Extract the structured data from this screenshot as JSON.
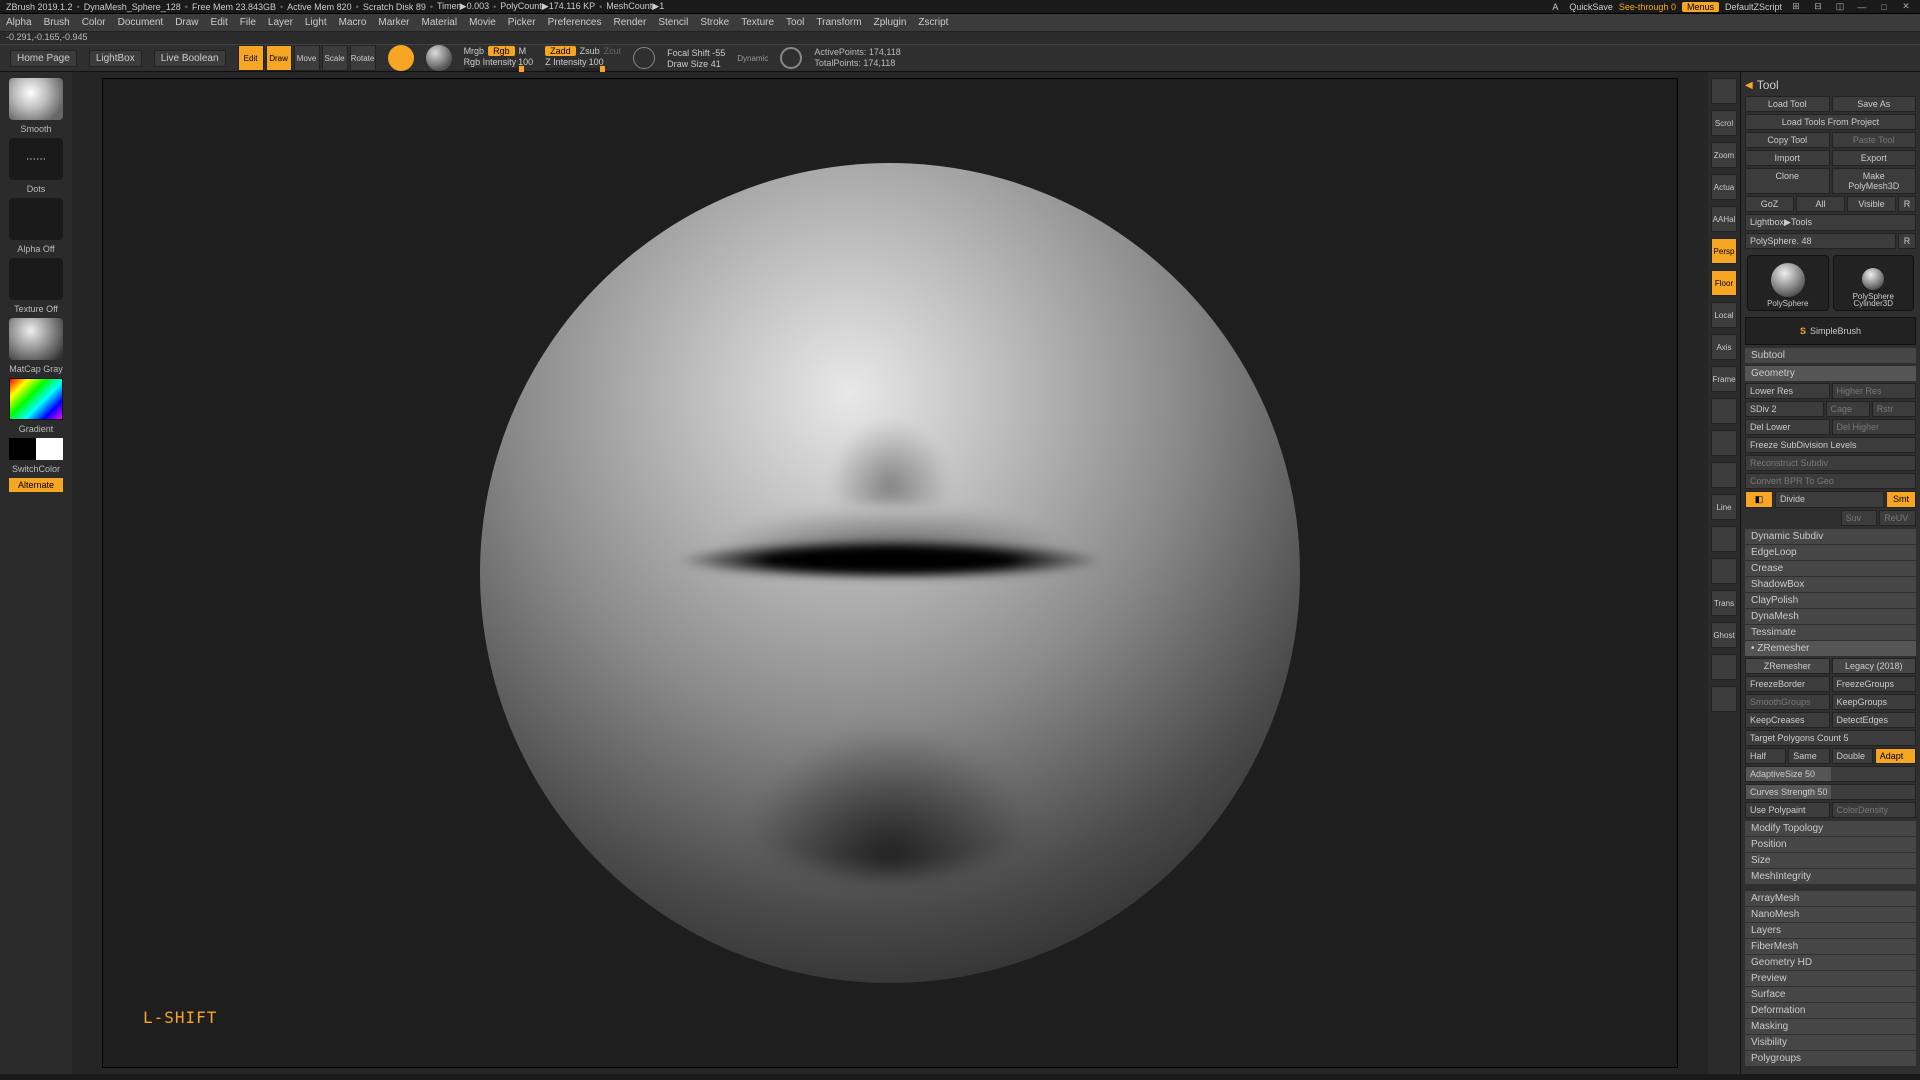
{
  "top": {
    "app": "ZBrush 2019.1.2",
    "project": "DynaMesh_Sphere_128",
    "freemem": "Free Mem 23.843GB",
    "activemem": "Active Mem 820",
    "scratch": "Scratch Disk 89",
    "timer": "Timer▶0.003",
    "polycount": "PolyCount▶174.116 KP",
    "meshcount": "MeshCount▶1",
    "adaptive": "A",
    "quicksave": "QuickSave",
    "seethrough": "See-through  0",
    "menus": "Menus",
    "defaultz": "DefaultZScript"
  },
  "menus": [
    "Alpha",
    "Brush",
    "Color",
    "Document",
    "Draw",
    "Edit",
    "File",
    "Layer",
    "Light",
    "Macro",
    "Marker",
    "Material",
    "Movie",
    "Picker",
    "Preferences",
    "Render",
    "Stencil",
    "Stroke",
    "Texture",
    "Tool",
    "Transform",
    "Zplugin",
    "Zscript"
  ],
  "coords": "-0.291,-0.165,-0.945",
  "shelf": {
    "home": "Home Page",
    "lightbox": "LightBox",
    "liveboolean": "Live Boolean",
    "modes": [
      "Edit",
      "Draw",
      "Move",
      "Scale",
      "Rotate"
    ],
    "mrgb": "Mrgb",
    "rgb": "Rgb",
    "m": "M",
    "rgbint_label": "Rgb Intensity",
    "rgbint": "100",
    "zadd": "Zadd",
    "zsub": "Zsub",
    "zcut": "Zcut",
    "zint_label": "Z Intensity",
    "zint": "100",
    "focal_label": "Focal Shift",
    "focal": "-55",
    "draw_label": "Draw Size",
    "draw": "41",
    "dynamic": "Dynamic",
    "active": "ActivePoints: 174,118",
    "total": "TotalPoints: 174,118"
  },
  "left": {
    "brush": "Smooth",
    "stroke": "Dots",
    "alpha": "Alpha Off",
    "texture": "Texture Off",
    "material": "MatCap Gray",
    "gradient": "Gradient",
    "switch": "SwitchColor",
    "alternate": "Alternate"
  },
  "viewport": {
    "shortcut": "L-SHIFT"
  },
  "ricons": [
    "",
    "Scroll",
    "Zoom",
    "Actual",
    "AAHalf",
    "Persp",
    "Floor",
    "Local",
    "Axis",
    "Frame",
    "",
    "",
    "",
    "Line Fill",
    "",
    "",
    "Transp",
    "Ghost",
    "",
    ""
  ],
  "tool": {
    "title": "Tool",
    "row1": [
      "Load Tool",
      "Save As"
    ],
    "row2": [
      "Load Tools From Project"
    ],
    "row3": [
      "Copy Tool",
      "Paste Tool"
    ],
    "row4": [
      "Import",
      "Export"
    ],
    "row5": [
      "Clone",
      "Make PolyMesh3D"
    ],
    "row6": [
      "GoZ",
      "All",
      "Visible",
      "R"
    ],
    "lightbox": "Lightbox▶Tools",
    "toolname": "PolySphere. 48",
    "rbtn": "R",
    "tools": [
      "PolySphere",
      "PolySphere",
      "Cylinder3D"
    ],
    "simple": "SimpleBrush",
    "sections": [
      "Subtool",
      "Geometry"
    ],
    "geo": {
      "lowerres": "Lower Res",
      "higherres": "Higher Res",
      "sdiv": "SDiv 2",
      "cage": "Cage",
      "rstr": "Rstr",
      "dellow": "Del Lower",
      "delhigh": "Del Higher",
      "freeze": "Freeze SubDivision Levels",
      "recon": "Reconstruct Subdiv",
      "convert": "Convert BPR To Geo",
      "divide": "Divide",
      "smt": "Smt",
      "suv": "Suv",
      "reuv": "ReUV"
    },
    "accordions": [
      "Dynamic Subdiv",
      "EdgeLoop",
      "Crease",
      "ShadowBox",
      "ClayPolish",
      "DynaMesh",
      "Tessimate",
      "ZRemesher"
    ],
    "zrem": {
      "btn": "ZRemesher",
      "legacy": "Legacy (2018)",
      "freezeb": "FreezeBorder",
      "freezeg": "FreezeGroups",
      "smoothg": "SmoothGroups",
      "keepg": "KeepGroups",
      "keepc": "KeepCreases",
      "detecte": "DetectEdges",
      "target": "Target Polygons Count 5",
      "half": "Half",
      "same": "Same",
      "double": "Double",
      "adapt": "Adapt",
      "adsize": "AdaptiveSize 50",
      "curves": "Curves Strength 50",
      "usepoly": "Use Polypaint",
      "colordense": "ColorDensity"
    },
    "rest": [
      "Modify Topology",
      "Position",
      "Size",
      "MeshIntegrity",
      "",
      "ArrayMesh",
      "NanoMesh",
      "Layers",
      "FiberMesh",
      "Geometry HD",
      "Preview",
      "Surface",
      "Deformation",
      "Masking",
      "Visibility",
      "Polygroups"
    ]
  }
}
